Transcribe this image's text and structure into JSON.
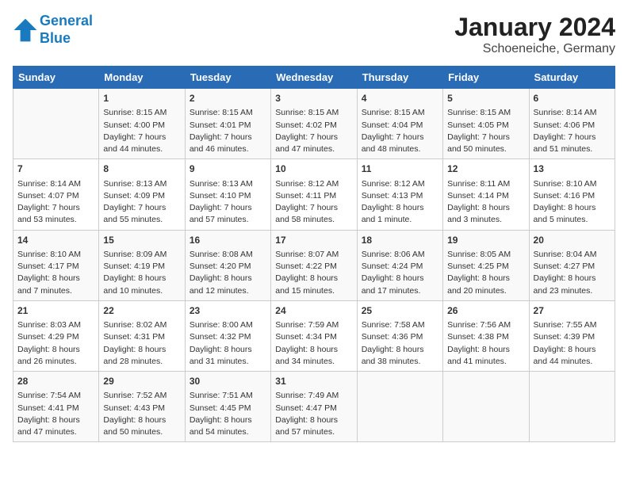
{
  "header": {
    "logo_line1": "General",
    "logo_line2": "Blue",
    "month": "January 2024",
    "location": "Schoeneiche, Germany"
  },
  "weekdays": [
    "Sunday",
    "Monday",
    "Tuesday",
    "Wednesday",
    "Thursday",
    "Friday",
    "Saturday"
  ],
  "weeks": [
    [
      {
        "day": "",
        "content": ""
      },
      {
        "day": "1",
        "content": "Sunrise: 8:15 AM\nSunset: 4:00 PM\nDaylight: 7 hours\nand 44 minutes."
      },
      {
        "day": "2",
        "content": "Sunrise: 8:15 AM\nSunset: 4:01 PM\nDaylight: 7 hours\nand 46 minutes."
      },
      {
        "day": "3",
        "content": "Sunrise: 8:15 AM\nSunset: 4:02 PM\nDaylight: 7 hours\nand 47 minutes."
      },
      {
        "day": "4",
        "content": "Sunrise: 8:15 AM\nSunset: 4:04 PM\nDaylight: 7 hours\nand 48 minutes."
      },
      {
        "day": "5",
        "content": "Sunrise: 8:15 AM\nSunset: 4:05 PM\nDaylight: 7 hours\nand 50 minutes."
      },
      {
        "day": "6",
        "content": "Sunrise: 8:14 AM\nSunset: 4:06 PM\nDaylight: 7 hours\nand 51 minutes."
      }
    ],
    [
      {
        "day": "7",
        "content": "Sunrise: 8:14 AM\nSunset: 4:07 PM\nDaylight: 7 hours\nand 53 minutes."
      },
      {
        "day": "8",
        "content": "Sunrise: 8:13 AM\nSunset: 4:09 PM\nDaylight: 7 hours\nand 55 minutes."
      },
      {
        "day": "9",
        "content": "Sunrise: 8:13 AM\nSunset: 4:10 PM\nDaylight: 7 hours\nand 57 minutes."
      },
      {
        "day": "10",
        "content": "Sunrise: 8:12 AM\nSunset: 4:11 PM\nDaylight: 7 hours\nand 58 minutes."
      },
      {
        "day": "11",
        "content": "Sunrise: 8:12 AM\nSunset: 4:13 PM\nDaylight: 8 hours\nand 1 minute."
      },
      {
        "day": "12",
        "content": "Sunrise: 8:11 AM\nSunset: 4:14 PM\nDaylight: 8 hours\nand 3 minutes."
      },
      {
        "day": "13",
        "content": "Sunrise: 8:10 AM\nSunset: 4:16 PM\nDaylight: 8 hours\nand 5 minutes."
      }
    ],
    [
      {
        "day": "14",
        "content": "Sunrise: 8:10 AM\nSunset: 4:17 PM\nDaylight: 8 hours\nand 7 minutes."
      },
      {
        "day": "15",
        "content": "Sunrise: 8:09 AM\nSunset: 4:19 PM\nDaylight: 8 hours\nand 10 minutes."
      },
      {
        "day": "16",
        "content": "Sunrise: 8:08 AM\nSunset: 4:20 PM\nDaylight: 8 hours\nand 12 minutes."
      },
      {
        "day": "17",
        "content": "Sunrise: 8:07 AM\nSunset: 4:22 PM\nDaylight: 8 hours\nand 15 minutes."
      },
      {
        "day": "18",
        "content": "Sunrise: 8:06 AM\nSunset: 4:24 PM\nDaylight: 8 hours\nand 17 minutes."
      },
      {
        "day": "19",
        "content": "Sunrise: 8:05 AM\nSunset: 4:25 PM\nDaylight: 8 hours\nand 20 minutes."
      },
      {
        "day": "20",
        "content": "Sunrise: 8:04 AM\nSunset: 4:27 PM\nDaylight: 8 hours\nand 23 minutes."
      }
    ],
    [
      {
        "day": "21",
        "content": "Sunrise: 8:03 AM\nSunset: 4:29 PM\nDaylight: 8 hours\nand 26 minutes."
      },
      {
        "day": "22",
        "content": "Sunrise: 8:02 AM\nSunset: 4:31 PM\nDaylight: 8 hours\nand 28 minutes."
      },
      {
        "day": "23",
        "content": "Sunrise: 8:00 AM\nSunset: 4:32 PM\nDaylight: 8 hours\nand 31 minutes."
      },
      {
        "day": "24",
        "content": "Sunrise: 7:59 AM\nSunset: 4:34 PM\nDaylight: 8 hours\nand 34 minutes."
      },
      {
        "day": "25",
        "content": "Sunrise: 7:58 AM\nSunset: 4:36 PM\nDaylight: 8 hours\nand 38 minutes."
      },
      {
        "day": "26",
        "content": "Sunrise: 7:56 AM\nSunset: 4:38 PM\nDaylight: 8 hours\nand 41 minutes."
      },
      {
        "day": "27",
        "content": "Sunrise: 7:55 AM\nSunset: 4:39 PM\nDaylight: 8 hours\nand 44 minutes."
      }
    ],
    [
      {
        "day": "28",
        "content": "Sunrise: 7:54 AM\nSunset: 4:41 PM\nDaylight: 8 hours\nand 47 minutes."
      },
      {
        "day": "29",
        "content": "Sunrise: 7:52 AM\nSunset: 4:43 PM\nDaylight: 8 hours\nand 50 minutes."
      },
      {
        "day": "30",
        "content": "Sunrise: 7:51 AM\nSunset: 4:45 PM\nDaylight: 8 hours\nand 54 minutes."
      },
      {
        "day": "31",
        "content": "Sunrise: 7:49 AM\nSunset: 4:47 PM\nDaylight: 8 hours\nand 57 minutes."
      },
      {
        "day": "",
        "content": ""
      },
      {
        "day": "",
        "content": ""
      },
      {
        "day": "",
        "content": ""
      }
    ]
  ]
}
